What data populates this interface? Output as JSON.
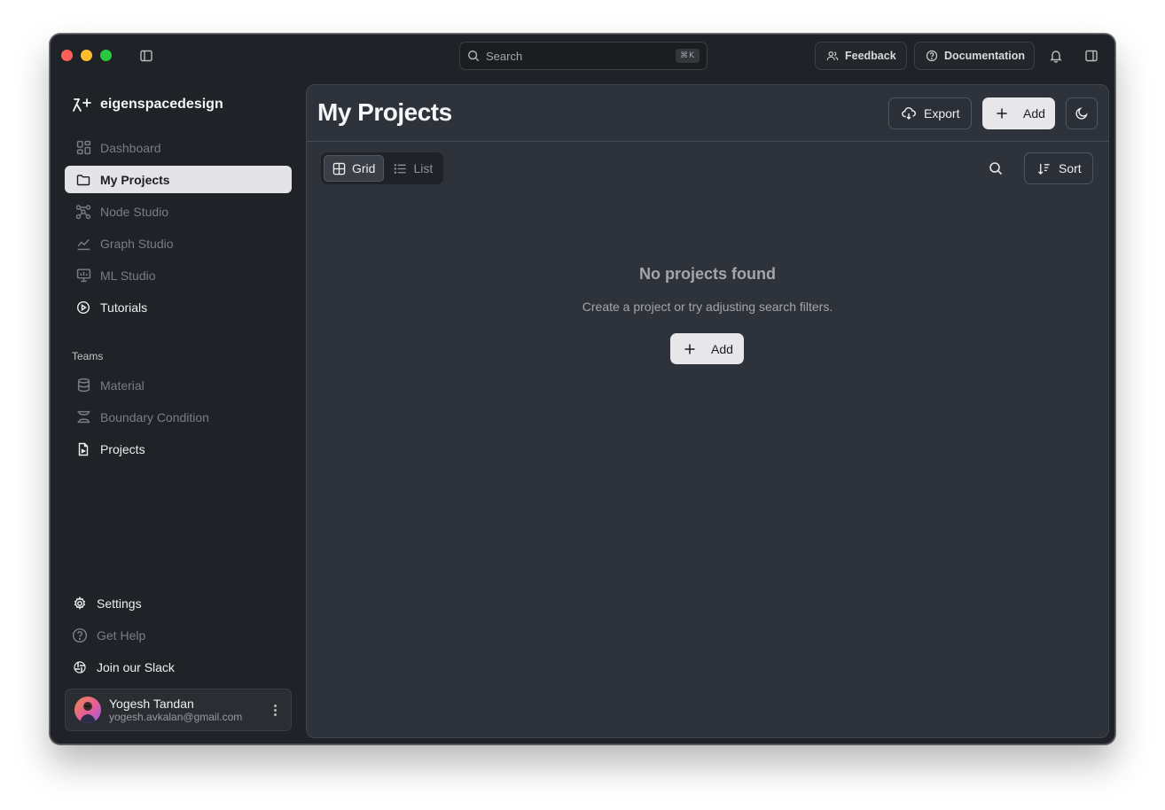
{
  "titlebar": {
    "search_placeholder": "Search",
    "shortcut": "⌘K",
    "feedback_label": "Feedback",
    "documentation_label": "Documentation"
  },
  "sidebar": {
    "brand": "eigenspacedesign",
    "items": [
      {
        "label": "Dashboard",
        "icon": "dashboard-icon"
      },
      {
        "label": "My Projects",
        "icon": "folder-icon"
      },
      {
        "label": "Node Studio",
        "icon": "nodes-icon"
      },
      {
        "label": "Graph Studio",
        "icon": "chart-line-icon"
      },
      {
        "label": "ML Studio",
        "icon": "presentation-icon"
      },
      {
        "label": "Tutorials",
        "icon": "play-circle-icon"
      }
    ],
    "teams_label": "Teams",
    "team_items": [
      {
        "label": "Material",
        "icon": "database-icon"
      },
      {
        "label": "Boundary Condition",
        "icon": "boundary-icon"
      },
      {
        "label": "Projects",
        "icon": "file-icon"
      }
    ],
    "footer_items": [
      {
        "label": "Settings",
        "icon": "gear-icon"
      },
      {
        "label": "Get Help",
        "icon": "help-circle-icon"
      },
      {
        "label": "Join our Slack",
        "icon": "slack-icon"
      }
    ],
    "user": {
      "name": "Yogesh Tandan",
      "email": "yogesh.avkalan@gmail.com"
    }
  },
  "main": {
    "title": "My Projects",
    "export_label": "Export",
    "add_label": "Add",
    "view_toggle": [
      "Grid",
      "List"
    ],
    "sort_label": "Sort",
    "empty_title": "No projects found",
    "empty_description": "Create a project or try adjusting search filters.",
    "empty_add_label": "Add"
  },
  "colors": {
    "window_bg": "#1f2227",
    "panel_bg": "#2e333b",
    "active_item_bg": "#e4e4e6",
    "light_button_bg": "#e7e7e9"
  }
}
